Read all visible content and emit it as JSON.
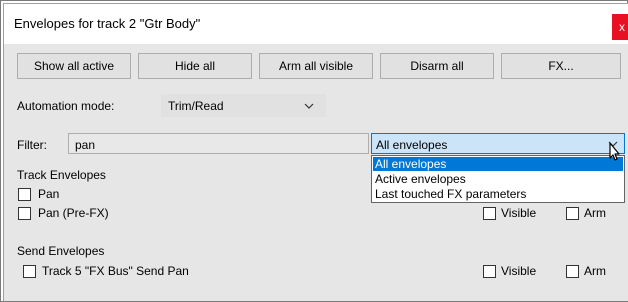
{
  "window": {
    "title": "Envelopes for track 2 \"Gtr Body\"",
    "close_glyph": "x"
  },
  "toolbar": {
    "show_all_active": "Show all active",
    "hide_all": "Hide all",
    "arm_all_visible": "Arm all visible",
    "disarm_all": "Disarm all",
    "fx": "FX..."
  },
  "automation": {
    "label": "Automation mode:",
    "value": "Trim/Read"
  },
  "filter": {
    "label": "Filter:",
    "value": "pan"
  },
  "envelope_select": {
    "value": "All envelopes",
    "options": [
      "All envelopes",
      "Active envelopes",
      "Last touched FX parameters"
    ],
    "selected_index": 0
  },
  "track_envelopes": {
    "heading": "Track Envelopes",
    "items": [
      {
        "label": "Pan"
      },
      {
        "label": "Pan (Pre-FX)",
        "visible": "Visible",
        "arm": "Arm"
      }
    ]
  },
  "send_envelopes": {
    "heading": "Send Envelopes",
    "items": [
      {
        "label": "Track 5 \"FX Bus\" Send Pan",
        "visible": "Visible",
        "arm": "Arm"
      }
    ]
  },
  "colors": {
    "accent": "#0078d7",
    "selection_bg": "#cce4f7",
    "close": "#e81123",
    "dialog_bg": "#e6e6e6"
  }
}
